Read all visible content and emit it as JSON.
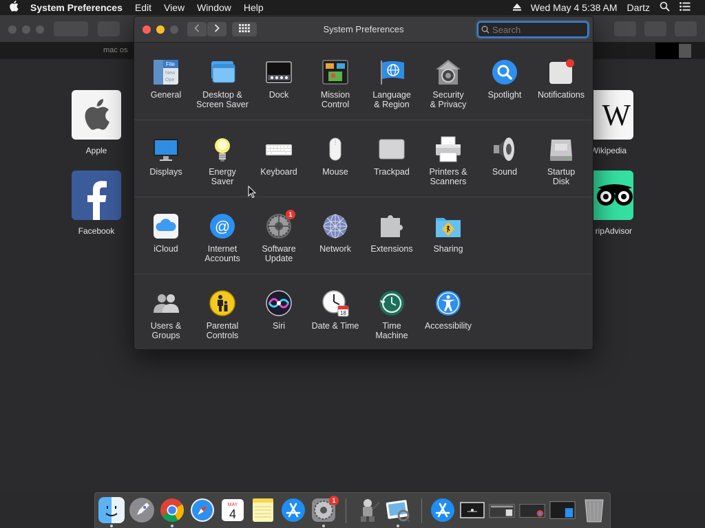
{
  "menubar": {
    "apple_icon": "apple-icon",
    "app_name": "System Preferences",
    "items": [
      "Edit",
      "View",
      "Window",
      "Help"
    ],
    "clock": "Wed May 4  5:38 AM",
    "user": "Dartz"
  },
  "browser": {
    "tab_text": "mac os",
    "favorites": [
      {
        "label": "Apple"
      },
      {
        "label": "Facebook"
      },
      {
        "label": "Wikipedia",
        "glyph": "W"
      },
      {
        "label": "ripAdvisor"
      }
    ]
  },
  "window": {
    "title": "System Preferences",
    "search_placeholder": "Search",
    "sections": [
      [
        {
          "label": "General",
          "icon": "general-icon"
        },
        {
          "label": "Desktop &\nScreen Saver",
          "icon": "desktop-icon"
        },
        {
          "label": "Dock",
          "icon": "dock-icon"
        },
        {
          "label": "Mission\nControl",
          "icon": "mission-control-icon"
        },
        {
          "label": "Language\n& Region",
          "icon": "language-region-icon"
        },
        {
          "label": "Security\n& Privacy",
          "icon": "security-icon"
        },
        {
          "label": "Spotlight",
          "icon": "spotlight-icon"
        },
        {
          "label": "Notifications",
          "icon": "notifications-icon"
        }
      ],
      [
        {
          "label": "Displays",
          "icon": "displays-icon"
        },
        {
          "label": "Energy\nSaver",
          "icon": "energy-saver-icon"
        },
        {
          "label": "Keyboard",
          "icon": "keyboard-icon"
        },
        {
          "label": "Mouse",
          "icon": "mouse-icon"
        },
        {
          "label": "Trackpad",
          "icon": "trackpad-icon"
        },
        {
          "label": "Printers &\nScanners",
          "icon": "printer-icon"
        },
        {
          "label": "Sound",
          "icon": "sound-icon"
        },
        {
          "label": "Startup\nDisk",
          "icon": "startup-disk-icon"
        }
      ],
      [
        {
          "label": "iCloud",
          "icon": "icloud-icon"
        },
        {
          "label": "Internet\nAccounts",
          "icon": "internet-accounts-icon"
        },
        {
          "label": "Software\nUpdate",
          "icon": "software-update-icon",
          "badge": "1"
        },
        {
          "label": "Network",
          "icon": "network-icon"
        },
        {
          "label": "Extensions",
          "icon": "extensions-icon"
        },
        {
          "label": "Sharing",
          "icon": "sharing-icon"
        }
      ],
      [
        {
          "label": "Users &\nGroups",
          "icon": "users-groups-icon"
        },
        {
          "label": "Parental\nControls",
          "icon": "parental-controls-icon"
        },
        {
          "label": "Siri",
          "icon": "siri-icon"
        },
        {
          "label": "Date & Time",
          "icon": "date-time-icon",
          "calendar_text": "18"
        },
        {
          "label": "Time\nMachine",
          "icon": "time-machine-icon"
        },
        {
          "label": "Accessibility",
          "icon": "accessibility-icon"
        }
      ]
    ]
  },
  "dock": {
    "calendar_month": "MAY",
    "calendar_day": "4",
    "prefs_badge": "1",
    "items": [
      "finder-icon",
      "launchpad-icon",
      "chrome-icon",
      "safari-icon",
      "calendar-icon",
      "notes-icon",
      "app-store-icon",
      "system-preferences-icon",
      "automator-icon",
      "preview-icon",
      "app-store-folder-icon",
      "screenshot-icon",
      "window-thumb-icon",
      "window-thumb-icon-2",
      "window-thumb-icon-3",
      "trash-icon"
    ]
  },
  "colors": {
    "accent": "#3d86d8",
    "badge": "#e5372e",
    "window_bg": "#323234",
    "menubar_bg": "#1e1e1f"
  }
}
